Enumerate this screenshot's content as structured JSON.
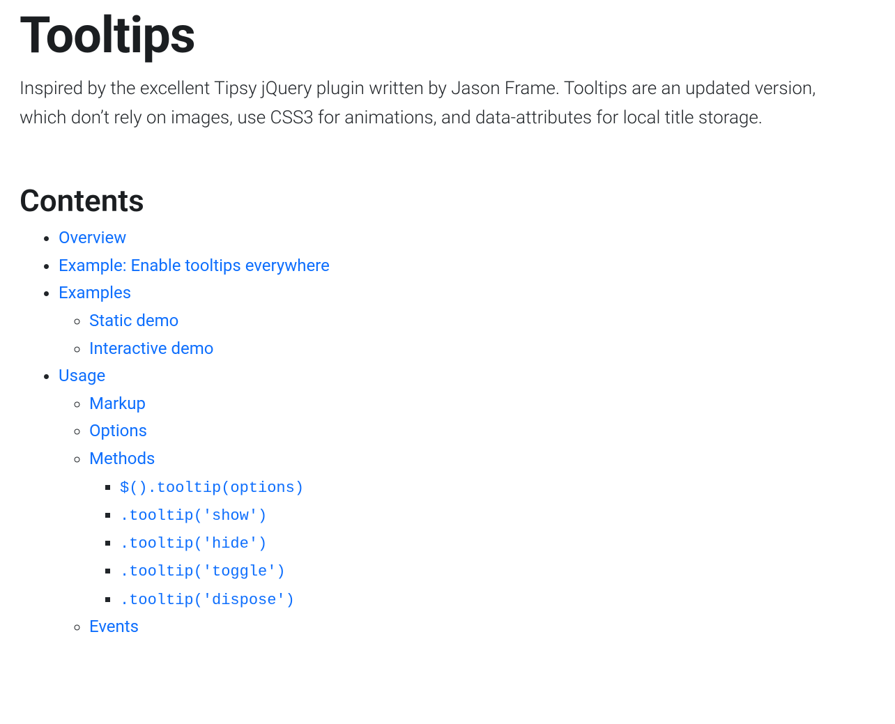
{
  "title": "Tooltips",
  "lead": "Inspired by the excellent Tipsy jQuery plugin written by Jason Frame. Tooltips are an updated version, which don’t rely on images, use CSS3 for animations, and data-attributes for local title storage.",
  "contents_heading": "Contents",
  "toc": {
    "overview": "Overview",
    "example_enable": "Example: Enable tooltips everywhere",
    "examples": "Examples",
    "static_demo": "Static demo",
    "interactive_demo": "Interactive demo",
    "usage": "Usage",
    "markup": "Markup",
    "options": "Options",
    "methods": "Methods",
    "method_options": "$().tooltip(options)",
    "method_show": ".tooltip('show')",
    "method_hide": ".tooltip('hide')",
    "method_toggle": ".tooltip('toggle')",
    "method_dispose": ".tooltip('dispose')",
    "events": "Events"
  }
}
